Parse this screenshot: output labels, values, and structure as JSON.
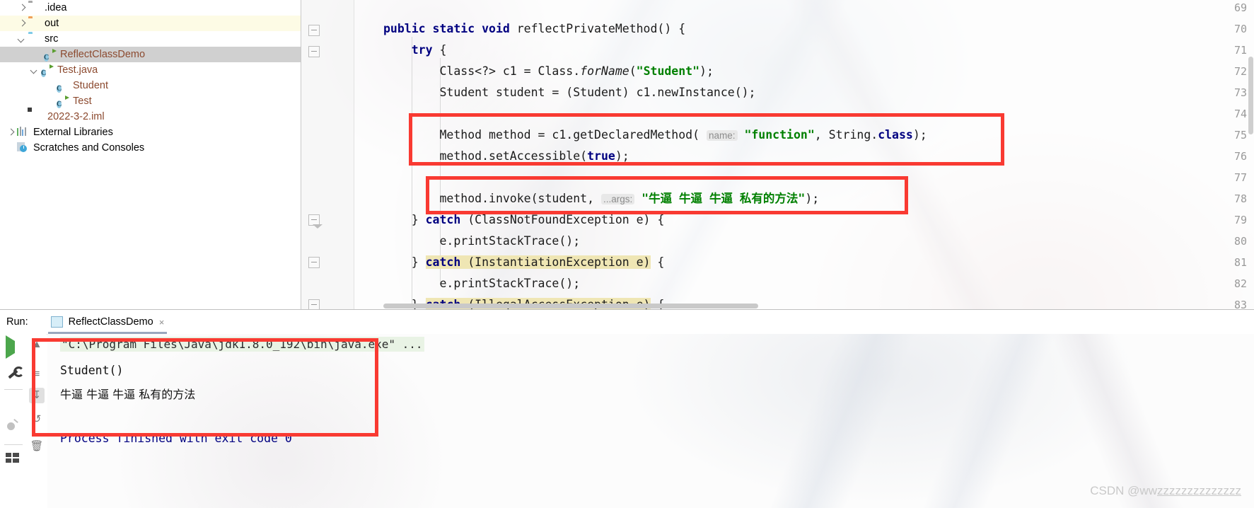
{
  "project_tree": {
    "items": [
      {
        "label": ".idea",
        "type": "folder-grey",
        "arrow": "collapsed",
        "indent": 0,
        "state": "normal"
      },
      {
        "label": "out",
        "type": "folder-orange",
        "arrow": "collapsed",
        "indent": 0,
        "state": "yellow"
      },
      {
        "label": "src",
        "type": "folder-blue",
        "arrow": "expanded",
        "indent": 0,
        "state": "normal"
      },
      {
        "label": "ReflectClassDemo",
        "type": "class-run",
        "arrow": "none",
        "indent": 2,
        "state": "selected"
      },
      {
        "label": "Test.java",
        "type": "class-run",
        "arrow": "expanded",
        "indent": 1,
        "state": "normal"
      },
      {
        "label": "Student",
        "type": "class",
        "arrow": "none",
        "indent": 2,
        "state": "normal"
      },
      {
        "label": "Test",
        "type": "class-run",
        "arrow": "none",
        "indent": 2,
        "state": "normal"
      },
      {
        "label": "2022-3-2.iml",
        "type": "iml",
        "arrow": "none",
        "indent": 1,
        "state": "normal"
      },
      {
        "label": "External Libraries",
        "type": "library",
        "arrow": "collapsed",
        "indent": 0,
        "state": "normal"
      },
      {
        "label": "Scratches and Consoles",
        "type": "scratch",
        "arrow": "none",
        "indent": 0,
        "state": "normal"
      }
    ]
  },
  "editor": {
    "line_numbers": [
      "69",
      "70",
      "71",
      "72",
      "73",
      "74",
      "75",
      "76",
      "77",
      "78",
      "79",
      "80",
      "81",
      "82",
      "83"
    ],
    "lines": [
      {
        "num": "69",
        "text": ""
      },
      {
        "num": "70",
        "text": "public static void reflectPrivateMethod() {"
      },
      {
        "num": "71",
        "text": "    try {"
      },
      {
        "num": "72",
        "text": "        Class<?> c1 = Class.forName(\"Student\");"
      },
      {
        "num": "73",
        "text": "        Student student = (Student) c1.newInstance();"
      },
      {
        "num": "74",
        "text": ""
      },
      {
        "num": "75",
        "text": "        Method method = c1.getDeclaredMethod( name: \"function\", String.class);"
      },
      {
        "num": "76",
        "text": "        method.setAccessible(true);"
      },
      {
        "num": "77",
        "text": ""
      },
      {
        "num": "78",
        "text": "        method.invoke(student, ...args: \"牛逼 牛逼 牛逼 私有的方法\");"
      },
      {
        "num": "79",
        "text": "    } catch (ClassNotFoundException e) {"
      },
      {
        "num": "80",
        "text": "        e.printStackTrace();"
      },
      {
        "num": "81",
        "text": "    } catch (InstantiationException e) {"
      },
      {
        "num": "82",
        "text": "        e.printStackTrace();"
      },
      {
        "num": "83",
        "text": "    } catch (IllegalAccessException e) {"
      }
    ],
    "parameter_hints": [
      "name:",
      "...args:"
    ],
    "string_literals": [
      "\"Student\"",
      "\"function\"",
      "\"牛逼 牛逼 牛逼 私有的方法\""
    ],
    "keywords": [
      "public",
      "static",
      "void",
      "try",
      "catch",
      "true",
      "class"
    ],
    "annotation_color": "#f93a32"
  },
  "run_panel": {
    "label": "Run:",
    "tab_name": "ReflectClassDemo",
    "tab_close": "×",
    "console_lines": [
      {
        "text": "\"C:\\Program Files\\Java\\jdk1.8.0_192\\bin\\java.exe\" ...",
        "style": "command"
      },
      {
        "text": "Student()",
        "style": "plain"
      },
      {
        "text": "牛逼 牛逼 牛逼 私有的方法",
        "style": "cn"
      },
      {
        "text": "",
        "style": "plain"
      },
      {
        "text": "Process finished with exit code 0",
        "style": "exit"
      }
    ],
    "sidebar_icons": [
      "run-icon",
      "wrench-icon",
      "stop-icon",
      "debug-icon",
      "layout-icon"
    ],
    "console_toolbar_icons": [
      "scroll-up-icon",
      "print-icon",
      "scroll-to-end-icon",
      "soft-wrap-icon",
      "trash-icon"
    ]
  },
  "watermark": {
    "prefix": "CSDN @ww",
    "suffix": "zzzzzzzzzzzzzz"
  }
}
